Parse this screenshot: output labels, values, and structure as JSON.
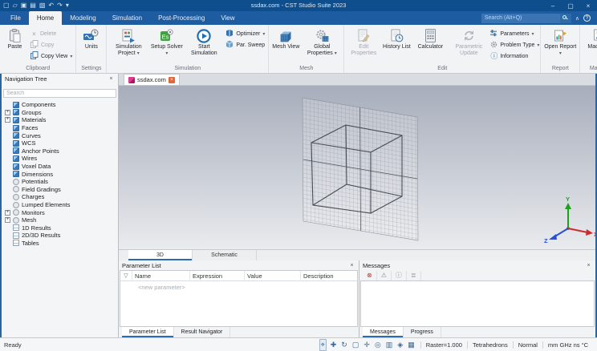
{
  "window": {
    "title": "ssdax.com - CST Studio Suite 2023",
    "quick_access": [
      {
        "name": "new-file-icon",
        "glyph": "▢"
      },
      {
        "name": "open-icon",
        "glyph": "▱"
      },
      {
        "name": "save-icon",
        "glyph": "▣"
      },
      {
        "name": "copy-icon",
        "glyph": "▤"
      },
      {
        "name": "export-icon",
        "glyph": "▧"
      },
      {
        "name": "undo-icon",
        "glyph": "↶"
      },
      {
        "name": "redo-icon",
        "glyph": "↷"
      },
      {
        "name": "more-icon",
        "glyph": "▾"
      }
    ],
    "controls": [
      {
        "name": "minimize-button",
        "glyph": "–"
      },
      {
        "name": "maximize-button",
        "glyph": "▢"
      },
      {
        "name": "close-button",
        "glyph": "×"
      }
    ]
  },
  "menu": {
    "tabs": [
      {
        "label": "File",
        "file": true
      },
      {
        "label": "Home",
        "active": true
      },
      {
        "label": "Modeling"
      },
      {
        "label": "Simulation"
      },
      {
        "label": "Post-Processing"
      },
      {
        "label": "View"
      }
    ],
    "search_placeholder": "Search (Alt+Q)"
  },
  "ribbon": {
    "clipboard": {
      "label": "Clipboard",
      "paste": "Paste",
      "delete": "Delete",
      "copy": "Copy",
      "copy_view": "Copy View"
    },
    "settings": {
      "label": "Settings",
      "units": "Units"
    },
    "simulation": {
      "label": "Simulation",
      "simulation_project": "Simulation Project",
      "setup_solver": "Setup Solver",
      "start_simulation": "Start Simulation",
      "optimizer": "Optimizer",
      "par_sweep": "Par. Sweep"
    },
    "mesh": {
      "label": "Mesh",
      "mesh_view": "Mesh View",
      "global_properties": "Global Properties"
    },
    "edit": {
      "label": "Edit",
      "edit_properties": "Edit Properties",
      "history_list": "History List",
      "calculator": "Calculator",
      "parametric_update": "Parametric Update",
      "parameters": "Parameters",
      "problem_type": "Problem Type",
      "information": "Information"
    },
    "report": {
      "label": "Report",
      "open_report": "Open Report"
    },
    "macros": {
      "label": "Macros",
      "macros": "Macros"
    }
  },
  "nav_tree": {
    "title": "Navigation Tree",
    "search_placeholder": "Search",
    "items": [
      {
        "label": "Components",
        "icon": "cube"
      },
      {
        "label": "Groups",
        "icon": "cube",
        "expandable": true
      },
      {
        "label": "Materials",
        "icon": "cube",
        "expandable": true
      },
      {
        "label": "Faces",
        "icon": "cube"
      },
      {
        "label": "Curves",
        "icon": "cube"
      },
      {
        "label": "WCS",
        "icon": "cube"
      },
      {
        "label": "Anchor Points",
        "icon": "cube"
      },
      {
        "label": "Wires",
        "icon": "cube"
      },
      {
        "label": "Voxel Data",
        "icon": "cube"
      },
      {
        "label": "Dimensions",
        "icon": "cube"
      },
      {
        "label": "Potentials",
        "icon": "circle"
      },
      {
        "label": "Field Gradings",
        "icon": "circle"
      },
      {
        "label": "Charges",
        "icon": "circle"
      },
      {
        "label": "Lumped Elements",
        "icon": "circle"
      },
      {
        "label": "Monitors",
        "icon": "circle",
        "expandable": true
      },
      {
        "label": "Mesh",
        "icon": "circle",
        "expandable": true
      },
      {
        "label": "1D Results",
        "icon": "chart"
      },
      {
        "label": "2D/3D Results",
        "icon": "chart"
      },
      {
        "label": "Tables",
        "icon": "chart"
      }
    ]
  },
  "document": {
    "tab_label": "ssdax.com"
  },
  "viewport": {
    "view_tabs": [
      {
        "label": "3D",
        "active": true
      },
      {
        "label": "Schematic"
      }
    ],
    "axes": {
      "x": {
        "label": "X",
        "color": "#cf2b2b"
      },
      "y": {
        "label": "Y",
        "color": "#1ba11b"
      },
      "z": {
        "label": "Z",
        "color": "#2b4fcf"
      }
    }
  },
  "parameter_list": {
    "title": "Parameter List",
    "columns": [
      "Name",
      "Expression",
      "Value",
      "Description"
    ],
    "new_row": "<new parameter>",
    "tabs": [
      {
        "label": "Parameter List",
        "active": true
      },
      {
        "label": "Result Navigator"
      }
    ]
  },
  "messages": {
    "title": "Messages",
    "toolbar": [
      {
        "name": "error-filter-icon",
        "glyph": "⊗",
        "color": "#b03a2e"
      },
      {
        "name": "warning-filter-icon",
        "glyph": "⚠",
        "color": "#8a8f96"
      },
      {
        "name": "info-filter-icon",
        "glyph": "ⓘ",
        "color": "#8a8f96"
      },
      {
        "name": "details-icon",
        "glyph": "≣",
        "color": "#8a8f96"
      }
    ],
    "tabs": [
      {
        "label": "Messages",
        "active": true
      },
      {
        "label": "Progress"
      }
    ]
  },
  "status_bar": {
    "ready": "Ready",
    "icons": [
      {
        "name": "fit-view-icon",
        "glyph": "⌖",
        "pressed": true
      },
      {
        "name": "move-icon",
        "glyph": "✚"
      },
      {
        "name": "rotate-icon",
        "glyph": "↻"
      },
      {
        "name": "zoom-window-icon",
        "glyph": "▢"
      },
      {
        "name": "pan-icon",
        "glyph": "✛"
      },
      {
        "name": "zoom-icon",
        "glyph": "◎"
      },
      {
        "name": "split-view-icon",
        "glyph": "▥"
      },
      {
        "name": "view-cube-icon",
        "glyph": "◈"
      },
      {
        "name": "raster-icon",
        "glyph": "▦"
      }
    ],
    "segments": [
      "Raster=1.000",
      "Tetrahedrons",
      "Normal",
      "mm GHz ns °C"
    ]
  }
}
